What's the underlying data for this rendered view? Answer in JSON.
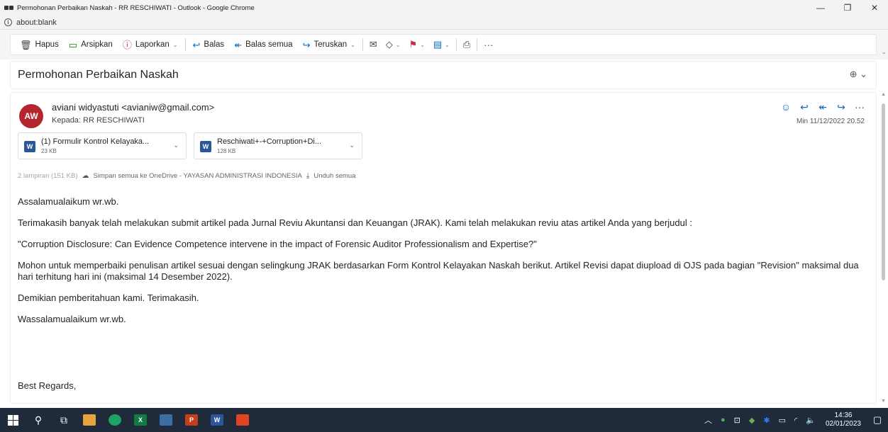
{
  "window": {
    "title": "Permohonan Perbaikan Naskah - RR RESCHIWATI - Outlook - Google Chrome",
    "minimize": "—",
    "restore": "❐",
    "close": "✕"
  },
  "address": {
    "url": "about:blank",
    "info_icon": "i"
  },
  "toolbar": {
    "hapus": "Hapus",
    "arsipkan": "Arsipkan",
    "laporkan": "Laporkan",
    "balas": "Balas",
    "balas_semua": "Balas semua",
    "teruskan": "Teruskan",
    "more": "···",
    "icons": [
      "trash-icon",
      "archive-icon",
      "report-icon",
      "reply-icon",
      "reply-all-icon",
      "forward-icon",
      "envelope-icon",
      "tag-icon",
      "flag-icon",
      "move-icon",
      "print-icon"
    ]
  },
  "subject": "Permohonan Perbaikan Naskah",
  "message": {
    "avatar_initials": "AW",
    "avatar_color": "#b4262d",
    "sender": "aviani widyastuti <avianiw@gmail.com>",
    "to": "Kepada:  RR RESCHIWATI",
    "date": "Min 11/12/2022 20.52",
    "attachments": [
      {
        "name": "(1) Formulir Kontrol Kelayaka...",
        "size": "23 KB",
        "type_icon": "W"
      },
      {
        "name": "Reschiwati+-+Corruption+Di...",
        "size": "128 KB",
        "type_icon": "W"
      }
    ],
    "attachment_summary": "2 lampiran (151 KB)",
    "save_onedrive": "Simpan semua ke OneDrive - YAYASAN ADMINISTRASI INDONESIA",
    "download_all": "Unduh semua",
    "body": {
      "greeting": "Assalamualaikum wr.wb.",
      "p1": "Terimakasih banyak telah melakukan submit artikel pada Jurnal Reviu Akuntansi dan Keuangan (JRAK). Kami telah melakukan reviu atas artikel Anda yang berjudul :",
      "p2": "\"Corruption Disclosure: Can Evidence Competence intervene in the impact of Forensic Auditor Professionalism and Expertise?\"",
      "p3": "Mohon untuk memperbaiki penulisan artikel sesuai dengan selingkung JRAK berdasarkan Form Kontrol Kelayakan Naskah berikut. Artikel Revisi dapat diupload di OJS pada bagian \"Revision\" maksimal dua hari terhitung hari ini (maksimal 14 Desember 2022).",
      "p4": "Demikian pemberitahuan kami. Terimakasih.",
      "closing": "Wassalamualaikum wr.wb.",
      "sign": "Best Regards,"
    }
  },
  "taskbar": {
    "time": "14:36",
    "date": "02/01/2023",
    "apps": [
      {
        "label": "",
        "color": "#e8a33d"
      },
      {
        "label": "",
        "color": "#1da462"
      },
      {
        "label": "X",
        "color": "#107c41"
      },
      {
        "label": "",
        "color": "#3a6ea5"
      },
      {
        "label": "P",
        "color": "#c43e1c"
      },
      {
        "label": "W",
        "color": "#2b579a"
      },
      {
        "label": "",
        "color": "#e2441f"
      }
    ]
  }
}
